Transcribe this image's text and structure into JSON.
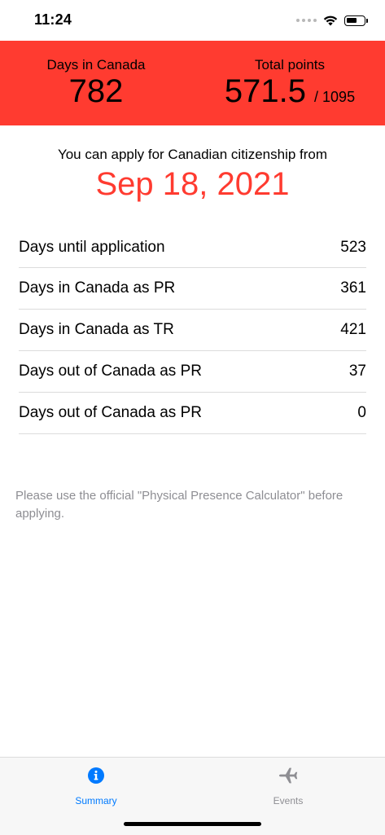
{
  "status_bar": {
    "time": "11:24",
    "icons": [
      "signal-dots-icon",
      "wifi-icon",
      "battery-icon"
    ]
  },
  "header": {
    "days_label": "Days in Canada",
    "days_value": "782",
    "points_label": "Total points",
    "points_value": "571.5",
    "points_total": "/ 1095",
    "accent_color": "#ff3b30"
  },
  "apply": {
    "text": "You can apply for Canadian citizenship from",
    "date": "Sep 18, 2021"
  },
  "rows": [
    {
      "label": "Days until application",
      "value": "523"
    },
    {
      "label": "Days in Canada as PR",
      "value": "361"
    },
    {
      "label": "Days in Canada as TR",
      "value": "421"
    },
    {
      "label": "Days out of Canada as PR",
      "value": "37"
    },
    {
      "label": "Days out of Canada as PR",
      "value": "0"
    }
  ],
  "note": "Please use the official \"Physical Presence Calculator\" before applying.",
  "tabs": [
    {
      "label": "Summary",
      "icon": "info-circle-icon",
      "selected": true,
      "color": "#007aff"
    },
    {
      "label": "Events",
      "icon": "airplane-icon",
      "selected": false,
      "color": "#8e8e93"
    }
  ]
}
